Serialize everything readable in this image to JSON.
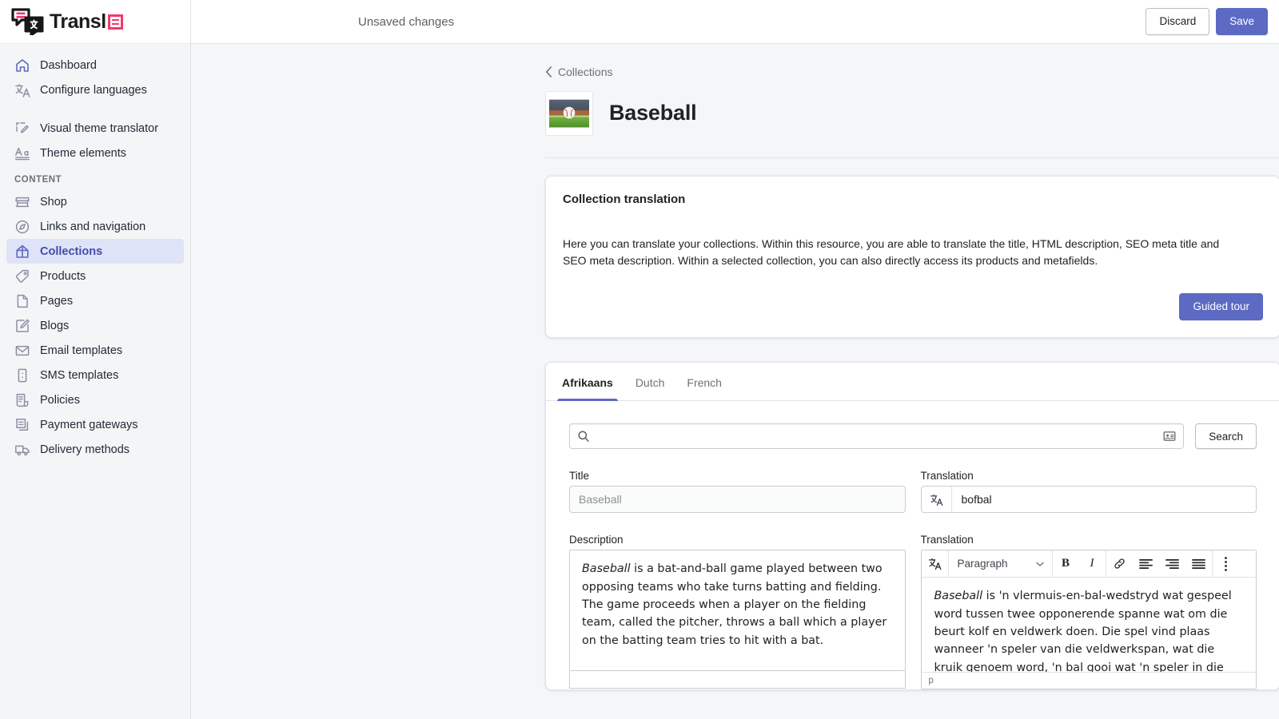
{
  "brand": {
    "name": "Transl",
    "logo_icon": "translation-bubbles-logo",
    "accent_color": "#f5386a",
    "primary_color": "#5c6ac4"
  },
  "sidebar": {
    "top_items": [
      {
        "label": "Dashboard",
        "icon": "home-icon"
      },
      {
        "label": "Configure languages",
        "icon": "language-swap-icon"
      }
    ],
    "tool_items": [
      {
        "label": "Visual theme translator",
        "icon": "theme-edit-icon"
      },
      {
        "label": "Theme elements",
        "icon": "typography-icon"
      }
    ],
    "section_label": "CONTENT",
    "content_items": [
      {
        "label": "Shop",
        "icon": "store-icon",
        "active": false
      },
      {
        "label": "Links and navigation",
        "icon": "compass-icon",
        "active": false
      },
      {
        "label": "Collections",
        "icon": "collection-icon",
        "active": true
      },
      {
        "label": "Products",
        "icon": "tag-icon",
        "active": false
      },
      {
        "label": "Pages",
        "icon": "page-icon",
        "active": false
      },
      {
        "label": "Blogs",
        "icon": "blog-pencil-icon",
        "active": false
      },
      {
        "label": "Email templates",
        "icon": "envelope-icon",
        "active": false
      },
      {
        "label": "SMS templates",
        "icon": "sms-icon",
        "active": false
      },
      {
        "label": "Policies",
        "icon": "policy-icon",
        "active": false
      },
      {
        "label": "Payment gateways",
        "icon": "payment-icon",
        "active": false
      },
      {
        "label": "Delivery methods",
        "icon": "truck-icon",
        "active": false
      }
    ]
  },
  "topbar": {
    "status": "Unsaved changes",
    "discard_label": "Discard",
    "save_label": "Save"
  },
  "page": {
    "breadcrumb": "Collections",
    "title": "Baseball",
    "thumbnail_alt": "baseball-photo"
  },
  "info_card": {
    "title": "Collection translation",
    "body": "Here you can translate your collections. Within this resource, you are able to translate the title, HTML description, SEO meta title and SEO meta description. Within a selected collection, you can also directly access its products and metafields.",
    "action_label": "Guided tour"
  },
  "tabs": [
    {
      "label": "Afrikaans",
      "active": true
    },
    {
      "label": "Dutch",
      "active": false
    },
    {
      "label": "French",
      "active": false
    }
  ],
  "search": {
    "value": "",
    "placeholder": "",
    "left_icon": "search-icon",
    "right_icon": "contact-card-icon",
    "button_label": "Search"
  },
  "fields": {
    "title": {
      "label": "Title",
      "source_value": "Baseball",
      "translation_label": "Translation",
      "translation_value": "bofbal",
      "translate_icon": "translate-icon"
    },
    "description": {
      "label": "Description",
      "source_text_lead": "Baseball",
      "source_text_rest": " is a bat-and-ball game played between two opposing teams who take turns batting and fielding. The game proceeds when a player on the fielding team, called the pitcher, throws a ball which a player on the batting team tries to hit with a bat.",
      "translation_label": "Translation",
      "translation_text_lead": "Baseball",
      "translation_text_rest": " is 'n vlermuis-en-bal-wedstryd wat gespeel word tussen twee opponerende spanne wat om die beurt kolf en veldwerk doen. Die spel vind plaas wanneer 'n speler van die veldwerkspan, wat die kruik genoem word, 'n bal gooi wat 'n speler in die kolfspan",
      "status_text": "p"
    }
  },
  "editor_toolbar": {
    "translate_icon": "translate-icon",
    "block_format": "Paragraph",
    "chevron_icon": "chevron-down-icon",
    "bold_label": "B",
    "italic_label": "I",
    "link_icon": "link-icon",
    "align_left_icon": "align-left-icon",
    "align_right_icon": "align-right-icon",
    "align_justify_icon": "align-justify-icon",
    "overflow_icon": "drag-dots-icon"
  }
}
